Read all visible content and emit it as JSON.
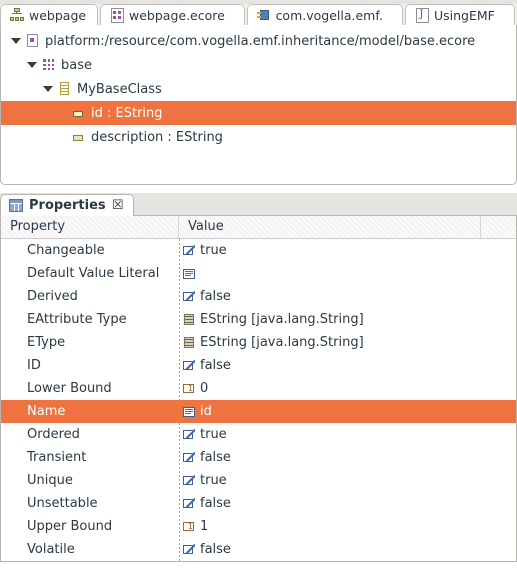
{
  "editor": {
    "tabs": [
      {
        "label": "webpage",
        "icon": "sitemap-icon",
        "active": false
      },
      {
        "label": "webpage.ecore",
        "icon": "ecore-file-icon",
        "active": false
      },
      {
        "label": "com.vogella.emf.",
        "icon": "plugin-icon",
        "active": false
      },
      {
        "label": "UsingEMF",
        "icon": "java-file-icon",
        "active": false
      }
    ],
    "tree": [
      {
        "label": "platform:/resource/com.vogella.emf.inheritance/model/base.ecore",
        "icon": "ecore-resource-icon",
        "indent": 0,
        "expanded": true,
        "selected": false
      },
      {
        "label": "base",
        "icon": "epackage-icon",
        "indent": 1,
        "expanded": true,
        "selected": false
      },
      {
        "label": "MyBaseClass",
        "icon": "eclass-icon",
        "indent": 2,
        "expanded": true,
        "selected": false
      },
      {
        "label": "id : EString",
        "icon": "eattribute-icon",
        "indent": 3,
        "expanded": false,
        "selected": true
      },
      {
        "label": "description : EString",
        "icon": "eattribute-icon",
        "indent": 3,
        "expanded": false,
        "selected": false
      }
    ]
  },
  "properties_view": {
    "tab_label": "Properties",
    "close_label": "☒",
    "columns": [
      "Property",
      "Value"
    ],
    "rows": [
      {
        "property": "Changeable",
        "value": "true",
        "value_icon": "boolean-icon",
        "selected": false
      },
      {
        "property": "Default Value Literal",
        "value": "",
        "value_icon": "text-icon",
        "selected": false
      },
      {
        "property": "Derived",
        "value": "false",
        "value_icon": "boolean-icon",
        "selected": false
      },
      {
        "property": "EAttribute Type",
        "value": "EString [java.lang.String]",
        "value_icon": "datatype-icon",
        "selected": false
      },
      {
        "property": "EType",
        "value": "EString [java.lang.String]",
        "value_icon": "datatype-icon",
        "selected": false
      },
      {
        "property": "ID",
        "value": "false",
        "value_icon": "boolean-icon",
        "selected": false
      },
      {
        "property": "Lower Bound",
        "value": "0",
        "value_icon": "number-icon",
        "selected": false
      },
      {
        "property": "Name",
        "value": "id",
        "value_icon": "text-icon",
        "selected": true
      },
      {
        "property": "Ordered",
        "value": "true",
        "value_icon": "boolean-icon",
        "selected": false
      },
      {
        "property": "Transient",
        "value": "false",
        "value_icon": "boolean-icon",
        "selected": false
      },
      {
        "property": "Unique",
        "value": "true",
        "value_icon": "boolean-icon",
        "selected": false
      },
      {
        "property": "Unsettable",
        "value": "false",
        "value_icon": "boolean-icon",
        "selected": false
      },
      {
        "property": "Upper Bound",
        "value": "1",
        "value_icon": "number-icon",
        "selected": false
      },
      {
        "property": "Volatile",
        "value": "false",
        "value_icon": "boolean-icon",
        "selected": false
      }
    ]
  },
  "colors": {
    "selection": "#ee7340",
    "selection_text": "#ffffff",
    "text": "#2b3a45",
    "panel_border": "#b8b5b0",
    "tabbar_bg": "#e6e4e1"
  }
}
